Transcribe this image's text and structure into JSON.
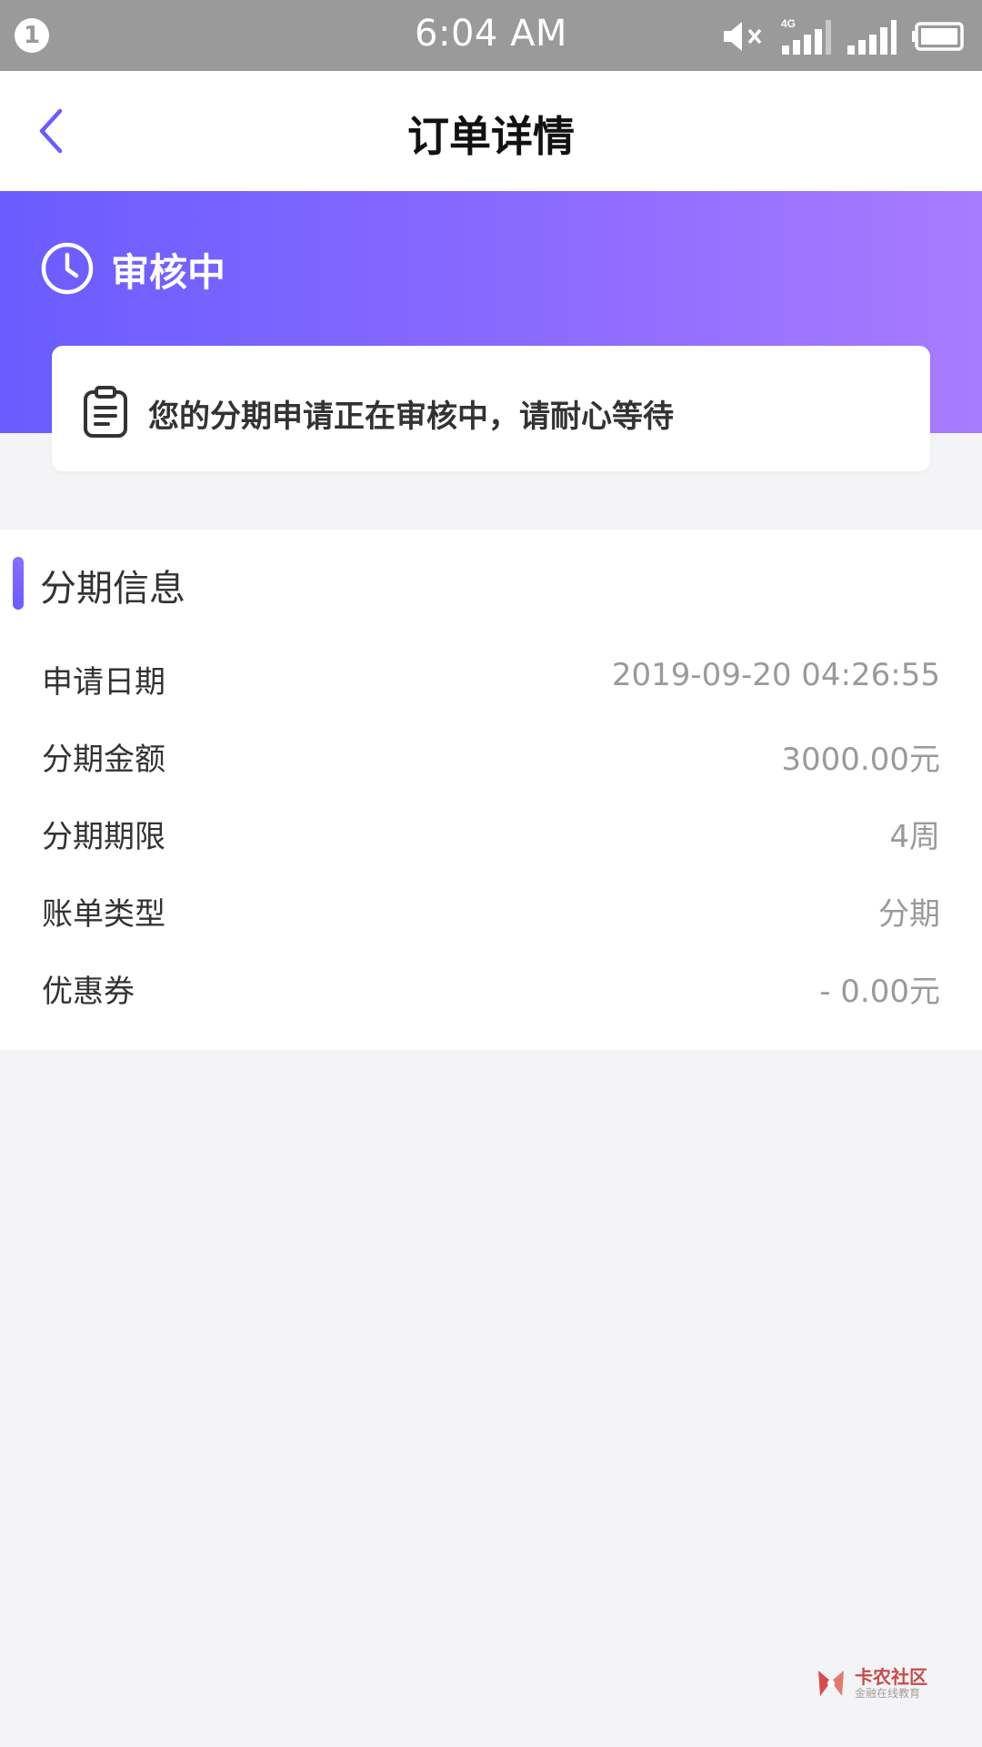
{
  "status_bar": {
    "notification_count": "1",
    "time": "6:04 AM",
    "icons": [
      "mute-icon",
      "signal-4g-icon",
      "signal-icon",
      "battery-icon"
    ],
    "network_label": "4G"
  },
  "nav": {
    "title": "订单详情"
  },
  "header": {
    "status": "审核中",
    "notice": "您的分期申请正在审核中，请耐心等待",
    "gradient": [
      "#6a5cff",
      "#a97bff"
    ]
  },
  "info": {
    "section_title": "分期信息",
    "rows": [
      {
        "label": "申请日期",
        "value": "2019-09-20 04:26:55"
      },
      {
        "label": "分期金额",
        "value": "3000.00元"
      },
      {
        "label": "分期期限",
        "value": "4周"
      },
      {
        "label": "账单类型",
        "value": "分期"
      },
      {
        "label": "优惠券",
        "value": "- 0.00元"
      }
    ]
  },
  "watermark": {
    "name": "卡农社区",
    "sub": "金融在线教育"
  },
  "colors": {
    "accent": "#6a5cff",
    "text_primary": "#333333",
    "text_secondary": "#9a9a9a",
    "status_bar": "#9a9a9a"
  }
}
